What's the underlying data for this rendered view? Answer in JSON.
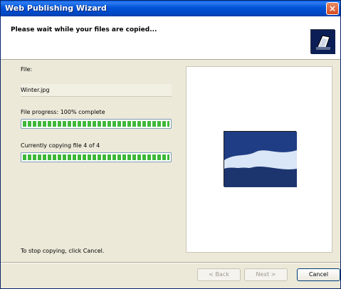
{
  "window": {
    "title": "Web Publishing Wizard",
    "close_symbol": "×"
  },
  "header": {
    "title": "Please wait while your files are copied...",
    "icon": "publishing-icon"
  },
  "file": {
    "label": "File:",
    "value": "Winter.jpg"
  },
  "file_progress": {
    "label": "File progress: 100% complete",
    "percent": 100
  },
  "overall_progress": {
    "label": "Currently copying file 4 of 4",
    "current": 4,
    "total": 4,
    "percent": 100
  },
  "hint": {
    "text": "To stop copying, click Cancel."
  },
  "buttons": {
    "back": "< Back",
    "next": "Next >",
    "cancel": "Cancel"
  },
  "colors": {
    "progress": "#3fb83a",
    "title_bar": "#0052d6"
  }
}
